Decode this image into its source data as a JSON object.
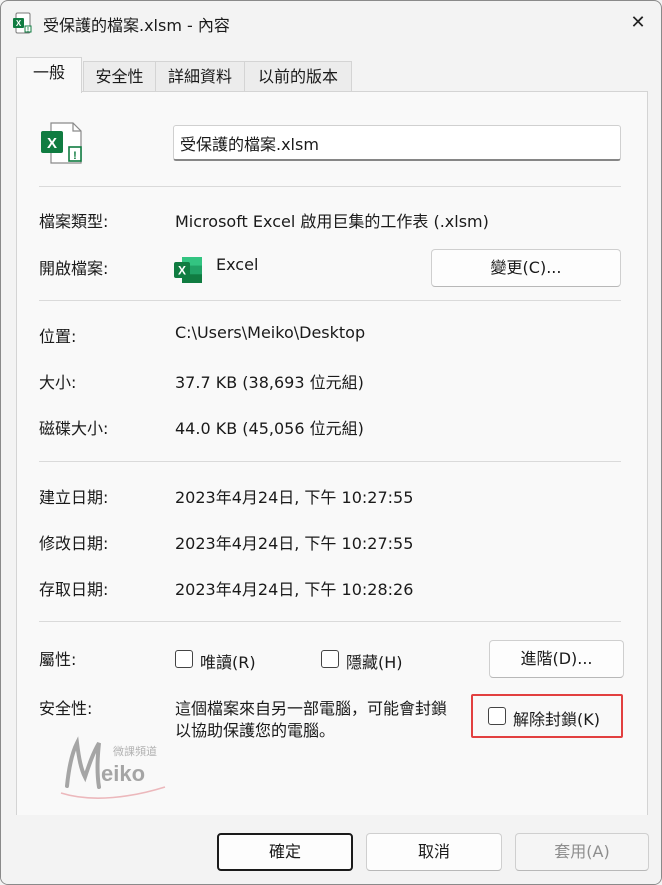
{
  "window": {
    "title": "受保護的檔案.xlsm - 內容",
    "close_glyph": "✕"
  },
  "tabs": [
    {
      "label": "一般",
      "active": true
    },
    {
      "label": "安全性",
      "active": false
    },
    {
      "label": "詳細資料",
      "active": false
    },
    {
      "label": "以前的版本",
      "active": false
    }
  ],
  "general": {
    "file_name": "受保護的檔案.xlsm",
    "type_label": "檔案類型:",
    "type_value": "Microsoft Excel 啟用巨集的工作表 (.xlsm)",
    "opens_with_label": "開啟檔案:",
    "opens_with_value": "Excel",
    "change_button": "變更(C)...",
    "location_label": "位置:",
    "location_value": "C:\\Users\\Meiko\\Desktop",
    "size_label": "大小:",
    "size_value": "37.7 KB (38,693 位元組)",
    "size_on_disk_label": "磁碟大小:",
    "size_on_disk_value": "44.0 KB (45,056 位元組)",
    "created_label": "建立日期:",
    "created_value": "2023年4月24日, 下午 10:27:55",
    "modified_label": "修改日期:",
    "modified_value": "2023年4月24日, 下午 10:27:55",
    "accessed_label": "存取日期:",
    "accessed_value": "2023年4月24日, 下午 10:28:26",
    "attributes_label": "屬性:",
    "readonly_label": "唯讀(R)",
    "hidden_label": "隱藏(H)",
    "advanced_button": "進階(D)...",
    "security_label": "安全性:",
    "security_text_line1": "這個檔案來自另一部電腦，可能會封鎖",
    "security_text_line2": "以協助保護您的電腦。",
    "unblock_label": "解除封鎖(K)"
  },
  "watermark": {
    "top_text": "微課頻道",
    "brand_text": "eiko"
  },
  "buttons": {
    "ok": "確定",
    "cancel": "取消",
    "apply": "套用(A)"
  },
  "colors": {
    "excel_green": "#107c41",
    "highlight_red": "#e24040",
    "watermark_pink": "#e8a3a8"
  }
}
